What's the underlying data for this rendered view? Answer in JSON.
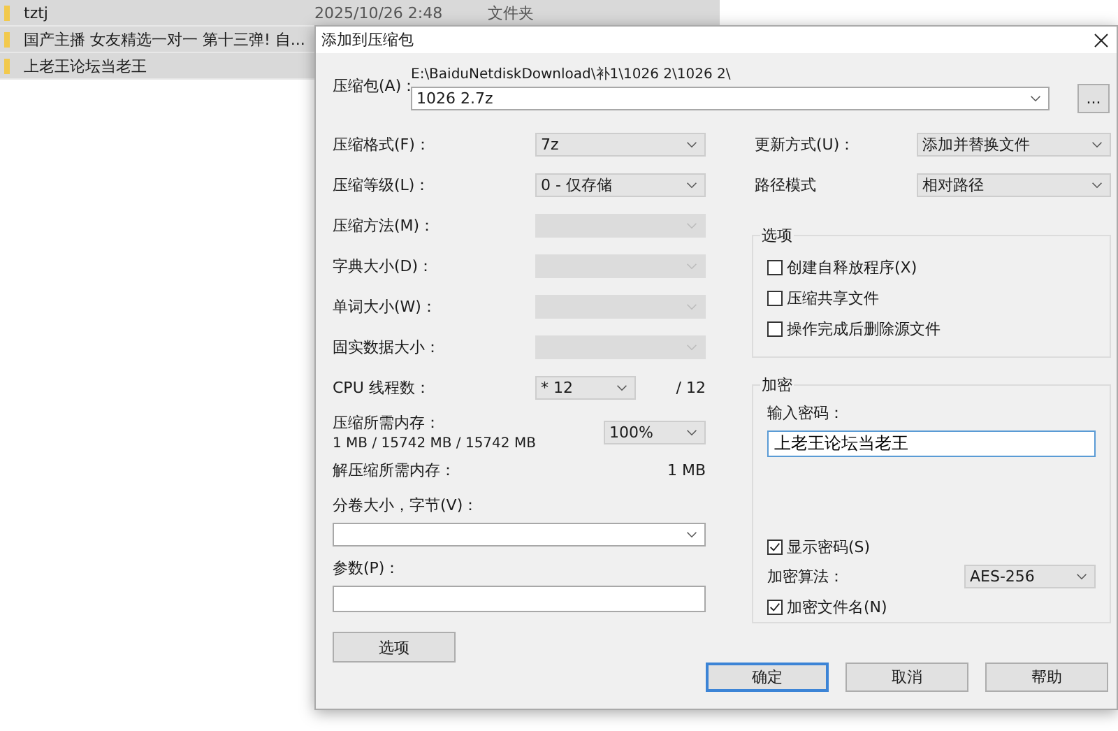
{
  "file_list": {
    "rows": [
      {
        "name": "tztj",
        "date": "2025/10/26 2:48",
        "type": "文件夹"
      },
      {
        "name": "国产主播 女友精选一对一 第十三弹! 自..."
      },
      {
        "name": "上老王论坛当老王"
      }
    ]
  },
  "dialog": {
    "title": "添加到压缩包",
    "archive": {
      "label": "压缩包(A)：",
      "path": "E:\\BaiduNetdiskDownload\\补1\\1026 2\\1026 2\\",
      "value": "1026 2.7z",
      "browse": "..."
    },
    "left_fields": [
      {
        "label": "压缩格式(F)：",
        "value": "7z",
        "disabled": false
      },
      {
        "label": "压缩等级(L)：",
        "value": "0 - 仅存储",
        "disabled": false
      },
      {
        "label": "压缩方法(M)：",
        "disabled": true
      },
      {
        "label": "字典大小(D)：",
        "disabled": true
      },
      {
        "label": "单词大小(W)：",
        "disabled": true
      },
      {
        "label": "固实数据大小：",
        "disabled": true
      }
    ],
    "cpu": {
      "label": "CPU 线程数：",
      "value": "* 12",
      "max": "/ 12"
    },
    "memory": {
      "label": "压缩所需内存：",
      "detail": "1 MB / 15742 MB / 15742 MB",
      "value": "100%"
    },
    "decompress_memory": {
      "label": "解压缩所需内存：",
      "value": "1 MB"
    },
    "volume": {
      "label": "分卷大小，字节(V)："
    },
    "params": {
      "label": "参数(P)："
    },
    "options_button": "选项",
    "right_fields": [
      {
        "label": "更新方式(U)：",
        "value": "添加并替换文件"
      },
      {
        "label": "路径模式",
        "value": "相对路径"
      }
    ],
    "options_group": {
      "title": "选项",
      "checkboxes": [
        {
          "label": "创建自释放程序(X)",
          "checked": false
        },
        {
          "label": "压缩共享文件",
          "checked": false
        },
        {
          "label": "操作完成后删除源文件",
          "checked": false
        }
      ]
    },
    "encryption": {
      "title": "加密",
      "password_label": "输入密码：",
      "password": "上老王论坛当老王",
      "show_password": {
        "label": "显示密码(S)",
        "checked": true
      },
      "method_label": "加密算法：",
      "method": "AES-256",
      "encrypt_names": {
        "label": "加密文件名(N)",
        "checked": true
      }
    },
    "buttons": [
      {
        "label": "确定",
        "focused": true
      },
      {
        "label": "取消",
        "focused": false
      },
      {
        "label": "帮助",
        "focused": false
      }
    ]
  }
}
